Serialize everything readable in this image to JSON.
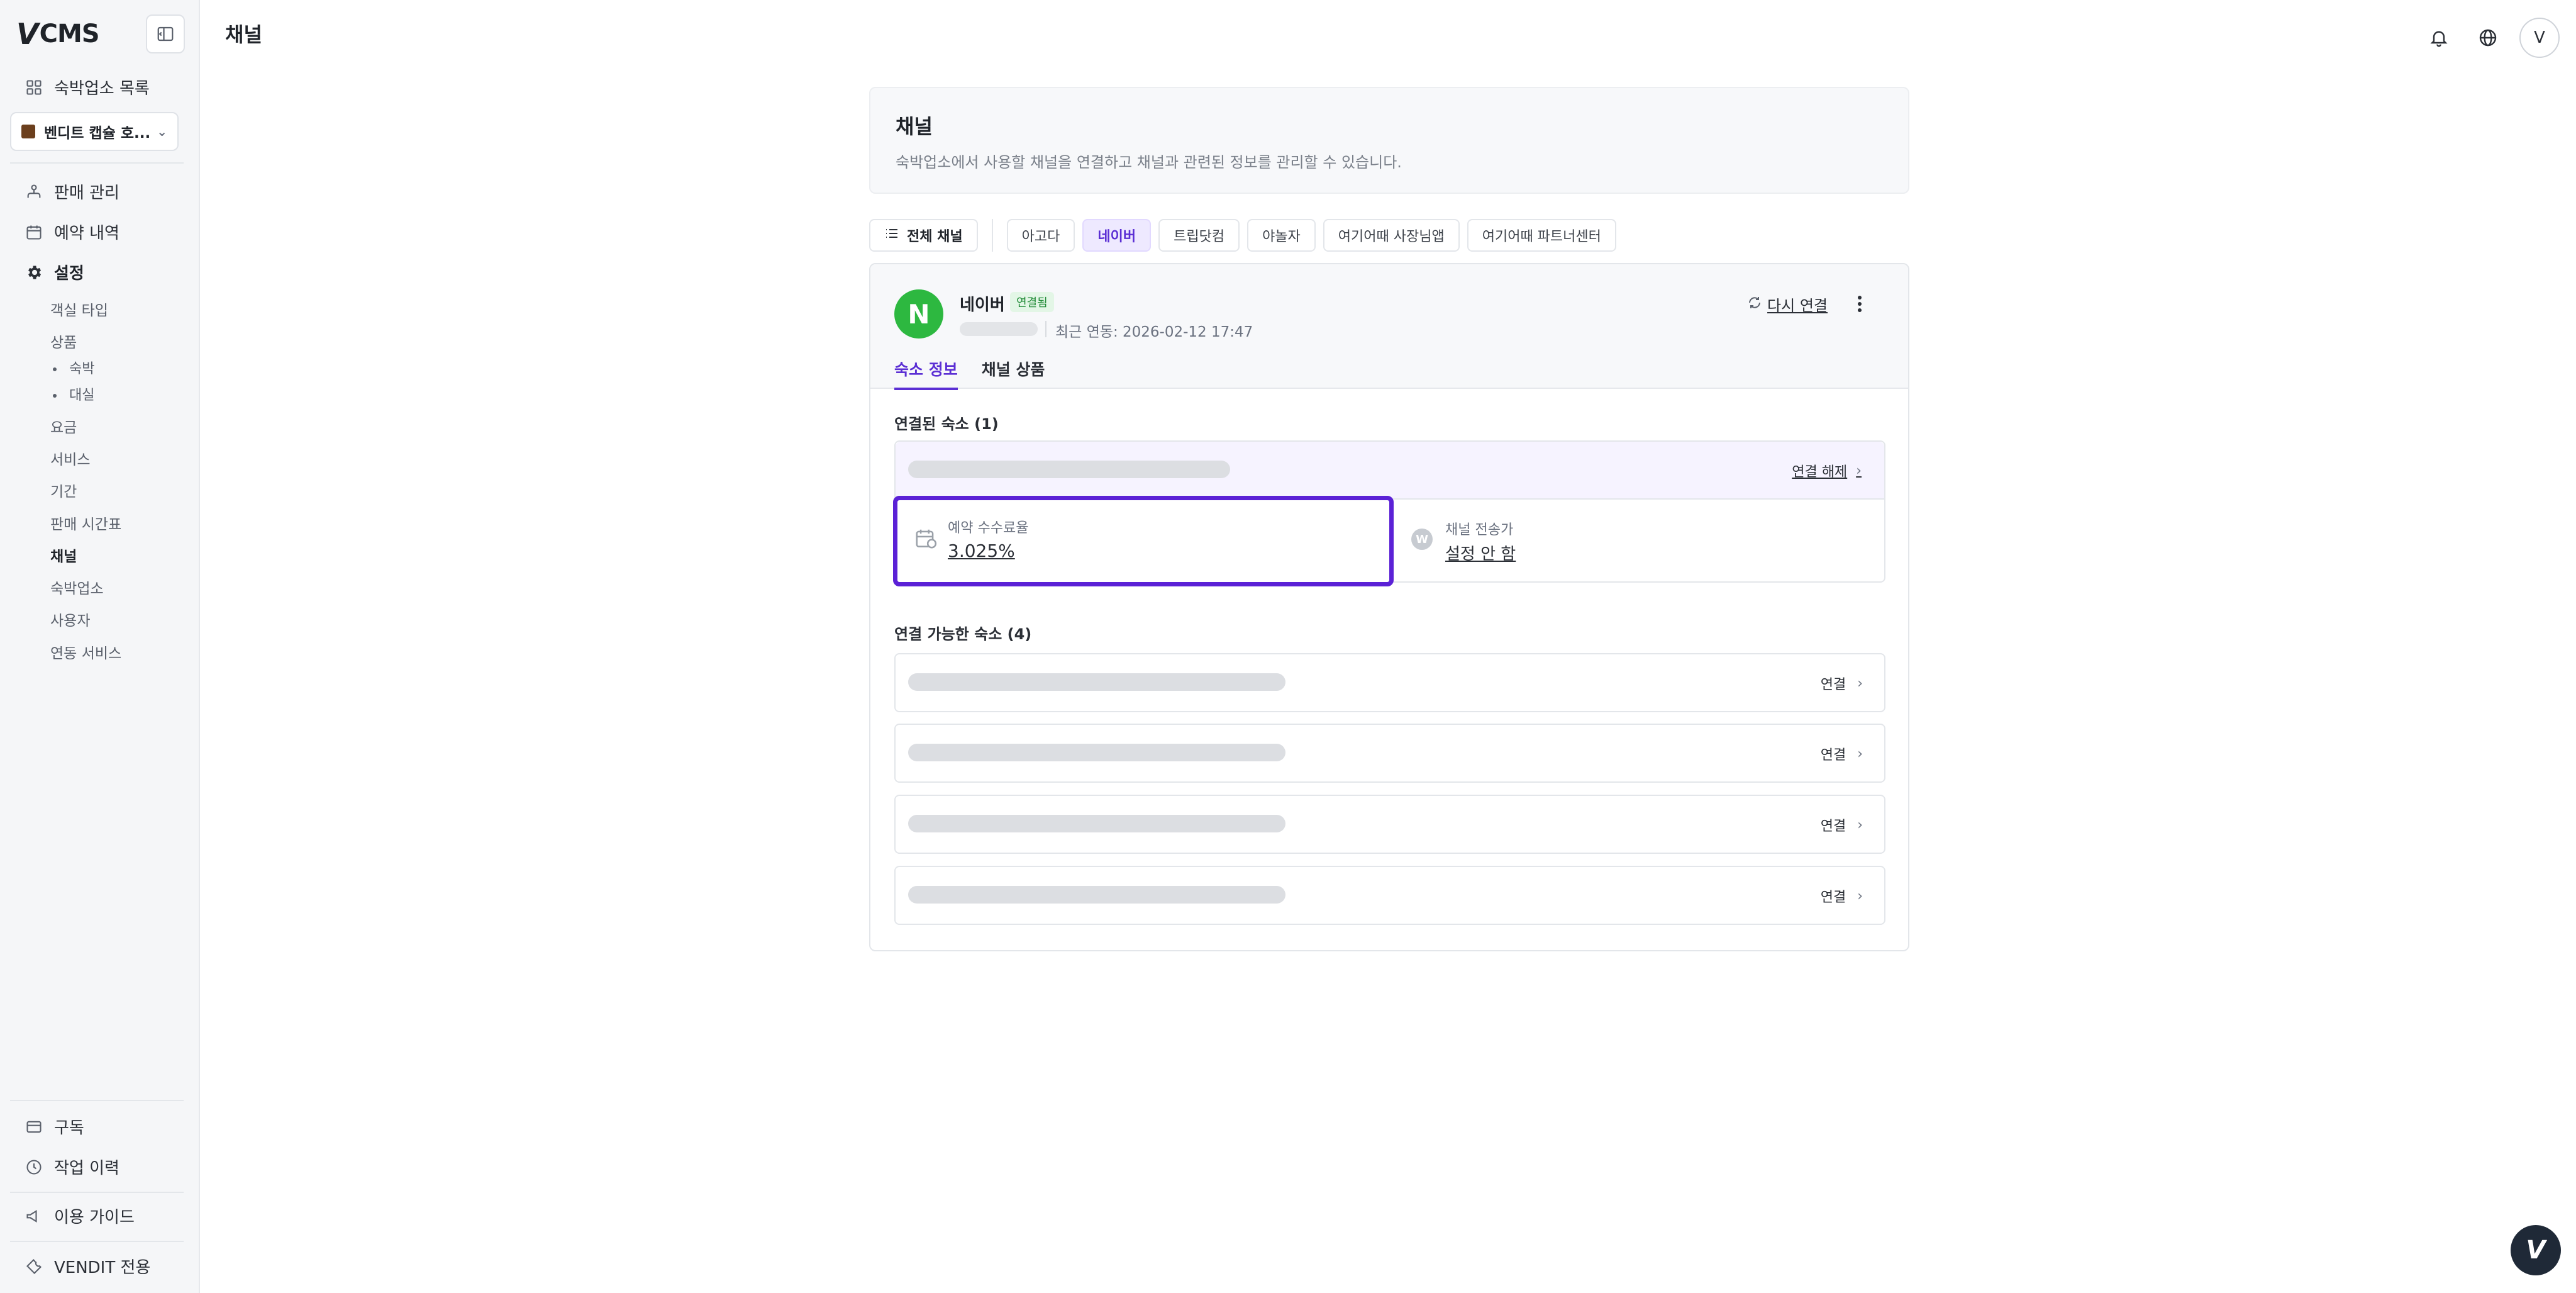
{
  "app": {
    "logo_mark": "V",
    "logo_text": "CMS"
  },
  "sidebar": {
    "property_list_label": "숙박업소 목록",
    "property_selector": "벤디트 캡슐 호...",
    "nav": [
      {
        "label": "판매 관리",
        "icon": "sitemap-icon"
      },
      {
        "label": "예약 내역",
        "icon": "calendar-icon"
      },
      {
        "label": "설정",
        "icon": "gear-icon"
      }
    ],
    "settings_items": {
      "room_type": "객실 타입",
      "product": "상품",
      "product_stay": "숙박",
      "product_rental": "대실",
      "rate": "요금",
      "service": "서비스",
      "period": "기간",
      "sales_timetable": "판매 시간표",
      "channel": "채널",
      "property": "숙박업소",
      "user": "사용자",
      "integration": "연동 서비스"
    },
    "bottom": {
      "subscription": "구독",
      "work_history": "작업 이력",
      "guide": "이용 가이드",
      "vendit_only": "VENDIT 전용"
    }
  },
  "header": {
    "title": "채널",
    "avatar_initial": "V"
  },
  "page": {
    "card_title": "채널",
    "card_description": "숙박업소에서 사용할 채널을 연결하고 채널과 관련된 정보를 관리할 수 있습니다."
  },
  "filters": {
    "all": "전체 채널",
    "channels": [
      "아고다",
      "네이버",
      "트립닷컴",
      "야놀자",
      "여기어때 사장님앱",
      "여기어때 파트너센터"
    ],
    "selected": "네이버"
  },
  "channel": {
    "logo_letter": "N",
    "logo_color": "#2db840",
    "name": "네이버",
    "status": "연결됨",
    "last_sync": "최근 연동: 2026-02-12 17:47",
    "reconnect": "다시 연결",
    "tabs": [
      "숙소 정보",
      "채널 상품"
    ],
    "active_tab": "숙소 정보",
    "connected_label": "연결된 숙소 (1)",
    "unlink": "연결 해제",
    "fee_label": "예약 수수료율",
    "fee_value": "3.025%",
    "rate_push_label": "채널 전송가",
    "rate_push_value": "설정 안 함",
    "rate_push_icon_letter": "W",
    "available_label": "연결 가능한 숙소 (4)",
    "connect": "연결"
  },
  "help_fab": "V",
  "colors": {
    "accent": "#5b2fd4",
    "naver_green": "#2db840"
  }
}
